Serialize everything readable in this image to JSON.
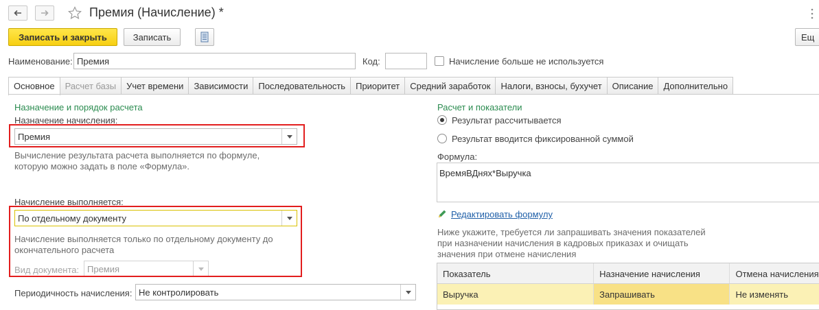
{
  "window": {
    "title": "Премия (Начисление) *"
  },
  "toolbar": {
    "save_close": "Записать и закрыть",
    "save": "Записать",
    "more": "Ещ"
  },
  "header": {
    "name_label": "Наименование:",
    "name_value": "Премия",
    "code_label": "Код:",
    "code_value": "",
    "unused_label": "Начисление больше не используется"
  },
  "tabs": [
    {
      "label": "Основное",
      "state": "active"
    },
    {
      "label": "Расчет базы",
      "state": "disabled"
    },
    {
      "label": "Учет времени",
      "state": "normal"
    },
    {
      "label": "Зависимости",
      "state": "normal"
    },
    {
      "label": "Последовательность",
      "state": "normal"
    },
    {
      "label": "Приоритет",
      "state": "normal"
    },
    {
      "label": "Средний заработок",
      "state": "normal"
    },
    {
      "label": "Налоги, взносы, бухучет",
      "state": "normal"
    },
    {
      "label": "Описание",
      "state": "normal"
    },
    {
      "label": "Дополнительно",
      "state": "normal"
    }
  ],
  "left": {
    "section_title": "Назначение и порядок расчета",
    "purpose_label": "Назначение начисления:",
    "purpose_value": "Премия",
    "purpose_hint_1": "Вычисление результата расчета выполняется по формуле,",
    "purpose_hint_2": "которую можно задать в поле «Формула».",
    "execution_label": "Начисление выполняется:",
    "execution_value": "По отдельному документу",
    "execution_hint_1": "Начисление выполняется только по отдельному документу до",
    "execution_hint_2": "окончательного расчета",
    "doc_type_label": "Вид документа:",
    "doc_type_value": "Премия",
    "periodicity_label": "Периодичность начисления:",
    "periodicity_value": "Не контролировать"
  },
  "right": {
    "section_title": "Расчет и показатели",
    "radio_calculated": "Результат рассчитывается",
    "radio_fixed": "Результат вводится фиксированной суммой",
    "formula_label": "Формула:",
    "formula_value": "ВремяВДнях*Выручка",
    "edit_formula_link": "Редактировать формулу",
    "indicators_hint_1": "Ниже укажите, требуется ли запрашивать значения показателей",
    "indicators_hint_2": "при назначении начисления в кадровых приказах и очищать",
    "indicators_hint_3": "значения при отмене начисления",
    "table": {
      "columns": [
        "Показатель",
        "Назначение начисления",
        "Отмена начисления"
      ],
      "rows": [
        [
          "Выручка",
          "Запрашивать",
          "Не изменять"
        ]
      ]
    }
  },
  "colors": {
    "accent_green": "#2a8b4f",
    "primary_button": "#f7cf12",
    "highlight_box": "#e21d1d",
    "selected_row": "#fbf1b5",
    "link": "#1f5fa8"
  }
}
